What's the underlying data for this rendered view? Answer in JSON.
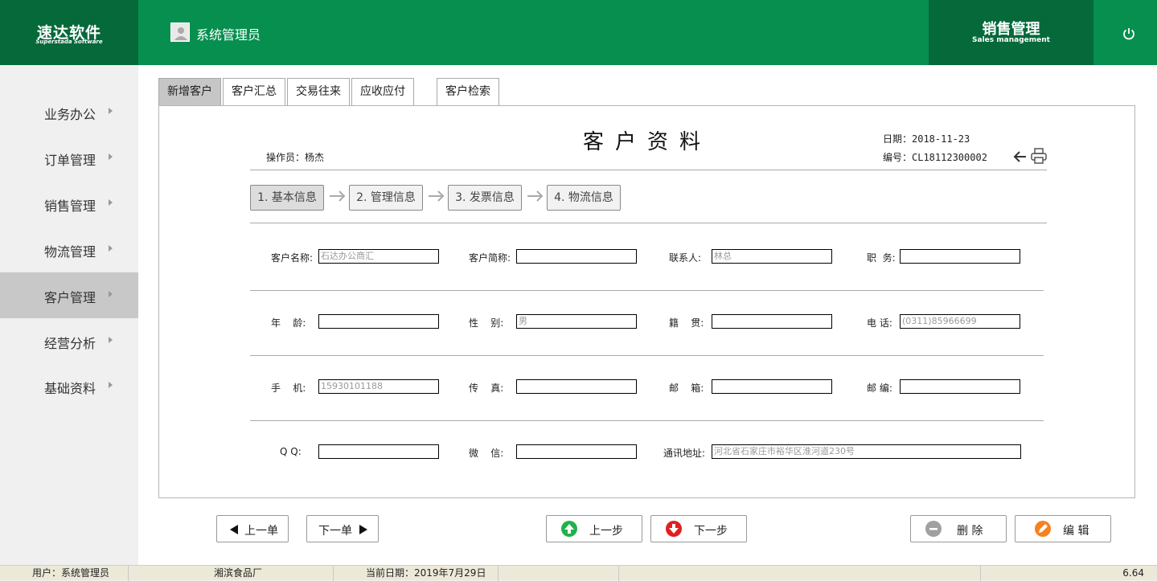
{
  "header": {
    "logo_main": "速达软件",
    "logo_sub": "Superstada Software",
    "user_name": "系统管理员",
    "module_main": "销售管理",
    "module_sub": "Sales management"
  },
  "sidebar": {
    "items": [
      {
        "label": "业务办公"
      },
      {
        "label": "订单管理"
      },
      {
        "label": "销售管理"
      },
      {
        "label": "物流管理"
      },
      {
        "label": "客户管理"
      },
      {
        "label": "经营分析"
      },
      {
        "label": "基础资料"
      }
    ],
    "active_index": 4
  },
  "tabs": [
    {
      "label": "新增客户"
    },
    {
      "label": "客户汇总"
    },
    {
      "label": "交易往来"
    },
    {
      "label": "应收应付"
    },
    {
      "label": "客户检索"
    }
  ],
  "document": {
    "title": "客户资料",
    "operator": "操作员：杨杰",
    "date": "日期：2018-11-23",
    "number": "编号：CL18112300002"
  },
  "steps": [
    {
      "label": "1. 基本信息"
    },
    {
      "label": "2. 管理信息"
    },
    {
      "label": "3. 发票信息"
    },
    {
      "label": "4. 物流信息"
    }
  ],
  "form": {
    "customer_name_label": "客户名称:",
    "customer_name_value": "石达办公商汇",
    "short_name_label": "客户简称:",
    "short_name_value": "",
    "contact_label": "联系人:",
    "contact_value": "林总",
    "position_label": "职  务:",
    "position_value": "",
    "age_label": "年    龄:",
    "age_value": "",
    "gender_label": "性    别:",
    "gender_value": "男",
    "hometown_label": "籍    贯:",
    "hometown_value": "",
    "phone_label": "电 话:",
    "phone_value": "(0311)85966699",
    "mobile_label": "手    机:",
    "mobile_value": "15930101188",
    "fax_label": "传    真:",
    "fax_value": "",
    "email_label": "邮    箱:",
    "email_value": "",
    "postcode_label": "邮 编:",
    "postcode_value": "",
    "qq_label": "Q Q:",
    "qq_value": "",
    "wechat_label": "微    信:",
    "wechat_value": "",
    "address_label": "通讯地址:",
    "address_value": "河北省石家庄市裕华区淮河道230号"
  },
  "buttons": {
    "prev_doc": "上一单",
    "next_doc": "下一单",
    "prev_step": "上一步",
    "next_step": "下一步",
    "delete": "删 除",
    "edit": "编 辑"
  },
  "statusbar": {
    "user": "用户：系统管理员",
    "company": "湘滨食品厂",
    "current_date": "当前日期：2019年7月29日",
    "version": "6.64"
  },
  "colors": {
    "header_green": "#068f4f",
    "dark_green": "#05693a",
    "prev_step_icon": "#22b14c",
    "next_step_icon": "#e02020",
    "delete_icon": "#a0a0a0",
    "edit_icon": "#f58220"
  }
}
